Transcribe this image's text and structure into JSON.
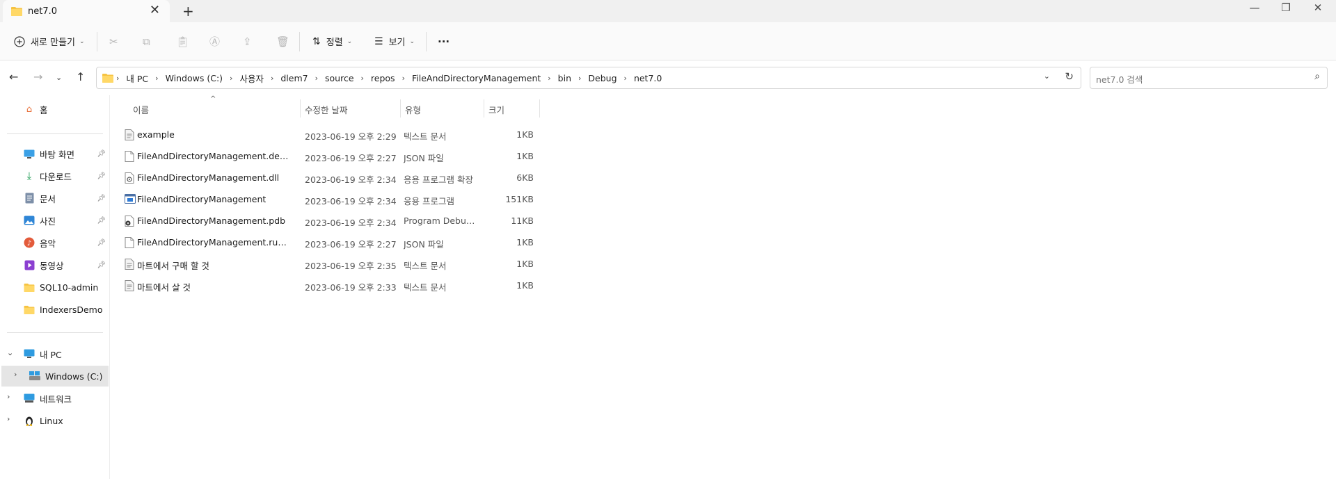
{
  "window": {
    "tab_title": "net7.0",
    "new_tab": "+",
    "close_tab": "✕",
    "minimize": "—",
    "maximize": "❐",
    "close": "✕"
  },
  "toolbar": {
    "new_label": "새로 만들기",
    "sort_label": "정렬",
    "view_label": "보기",
    "more_label": "···",
    "icons": [
      "cut-icon",
      "copy-icon",
      "paste-icon",
      "rename-icon",
      "share-icon",
      "delete-icon"
    ]
  },
  "address": {
    "crumbs": [
      "내 PC",
      "Windows (C:)",
      "사용자",
      "dlem7",
      "source",
      "repos",
      "FileAndDirectoryManagement",
      "bin",
      "Debug",
      "net7.0"
    ],
    "separator": "›"
  },
  "search": {
    "placeholder": "net7.0 검색"
  },
  "sidebar": {
    "home": "홈",
    "quick": [
      {
        "label": "바탕 화면",
        "icon": "desktop-icon",
        "pinned": true
      },
      {
        "label": "다운로드",
        "icon": "download-icon",
        "pinned": true
      },
      {
        "label": "문서",
        "icon": "documents-icon",
        "pinned": true
      },
      {
        "label": "사진",
        "icon": "pictures-icon",
        "pinned": true
      },
      {
        "label": "음악",
        "icon": "music-icon",
        "pinned": true
      },
      {
        "label": "동영상",
        "icon": "videos-icon",
        "pinned": true
      },
      {
        "label": "SQL10-admin",
        "icon": "folder-icon",
        "pinned": false
      },
      {
        "label": "IndexersDemo",
        "icon": "folder-icon",
        "pinned": false
      }
    ],
    "this_pc": "내 PC",
    "drive": "Windows (C:)",
    "network": "네트워크",
    "linux": "Linux"
  },
  "columns": {
    "name": "이름",
    "modified": "수정한 날짜",
    "type": "유형",
    "size": "크기"
  },
  "files": [
    {
      "name": "example",
      "modified": "2023-06-19 오후 2:29",
      "type": "텍스트 문서",
      "size": "1KB",
      "icon": "text-file-icon"
    },
    {
      "name": "FileAndDirectoryManagement.deps.json",
      "modified": "2023-06-19 오후 2:27",
      "type": "JSON 파일",
      "size": "1KB",
      "icon": "file-icon"
    },
    {
      "name": "FileAndDirectoryManagement.dll",
      "modified": "2023-06-19 오후 2:34",
      "type": "응용 프로그램 확장",
      "size": "6KB",
      "icon": "dll-file-icon"
    },
    {
      "name": "FileAndDirectoryManagement",
      "modified": "2023-06-19 오후 2:34",
      "type": "응용 프로그램",
      "size": "151KB",
      "icon": "exe-file-icon"
    },
    {
      "name": "FileAndDirectoryManagement.pdb",
      "modified": "2023-06-19 오후 2:34",
      "type": "Program Debug ...",
      "size": "11KB",
      "icon": "pdb-file-icon"
    },
    {
      "name": "FileAndDirectoryManagement.runtimec...",
      "modified": "2023-06-19 오후 2:27",
      "type": "JSON 파일",
      "size": "1KB",
      "icon": "file-icon"
    },
    {
      "name": "마트에서 구매 할 것",
      "modified": "2023-06-19 오후 2:35",
      "type": "텍스트 문서",
      "size": "1KB",
      "icon": "text-file-icon"
    },
    {
      "name": "마트에서 살 것",
      "modified": "2023-06-19 오후 2:33",
      "type": "텍스트 문서",
      "size": "1KB",
      "icon": "text-file-icon"
    }
  ],
  "colors": {
    "folder": "#f6c342",
    "accent": "#0067c0",
    "selected": "#e5e5e5"
  }
}
